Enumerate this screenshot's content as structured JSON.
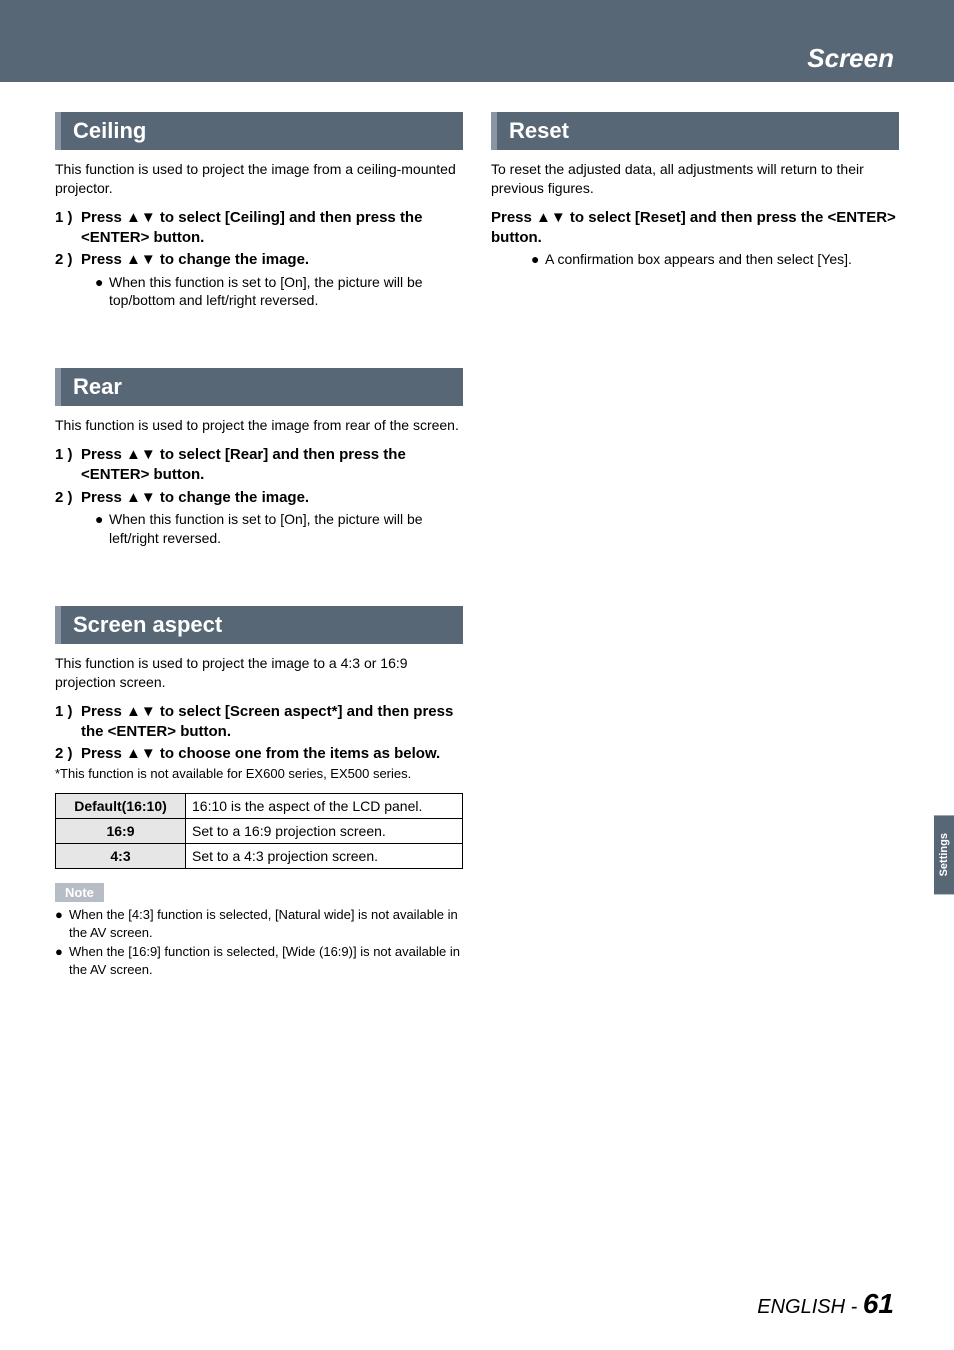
{
  "banner": {
    "title": "Screen"
  },
  "sideTab": "Settings",
  "footer": {
    "lang": "ENGLISH - ",
    "page": "61"
  },
  "left": {
    "ceiling": {
      "heading": "Ceiling",
      "intro": "This function is used to project the image from a ceiling-mounted projector.",
      "step1_num": "1 )",
      "step1": "Press ▲▼ to select [Ceiling] and then press the <ENTER> button.",
      "step2_num": "2 )",
      "step2": "Press ▲▼ to change the image.",
      "bullet": "When this function is set to [On], the picture will be top/bottom and left/right reversed."
    },
    "rear": {
      "heading": "Rear",
      "intro": "This function is used to project the image from rear of the screen.",
      "step1_num": "1 )",
      "step1": "Press ▲▼ to select [Rear] and then press the <ENTER> button.",
      "step2_num": "2 )",
      "step2": "Press ▲▼ to change the image.",
      "bullet": "When this function is set to [On], the picture will be left/right reversed."
    },
    "aspect": {
      "heading": "Screen aspect",
      "intro": "This function is used to project the image to a 4:3 or 16:9 projection screen.",
      "step1_num": "1 )",
      "step1": "Press ▲▼ to select [Screen aspect*] and then press the <ENTER> button.",
      "step2_num": "2 )",
      "step2": "Press ▲▼ to choose one from the items as below.",
      "footnote": "*This function is not available for EX600 series, EX500 series.",
      "rows": [
        {
          "label": "Default(16:10)",
          "desc": "16:10 is the aspect of the LCD panel."
        },
        {
          "label": "16:9",
          "desc": "Set to a 16:9 projection screen."
        },
        {
          "label": "4:3",
          "desc": "Set to a 4:3 projection screen."
        }
      ],
      "noteBadge": "Note",
      "notes": [
        "When the [4:3] function is selected, [Natural wide] is not available in the AV screen.",
        "When the [16:9] function is selected, [Wide (16:9)] is not available in the AV screen."
      ]
    }
  },
  "right": {
    "reset": {
      "heading": "Reset",
      "intro": "To reset the adjusted data, all adjustments will return to their previous figures.",
      "step": "Press ▲▼ to select [Reset] and then press the <ENTER> button.",
      "bullet": "A confirmation box appears and then select [Yes]."
    }
  }
}
